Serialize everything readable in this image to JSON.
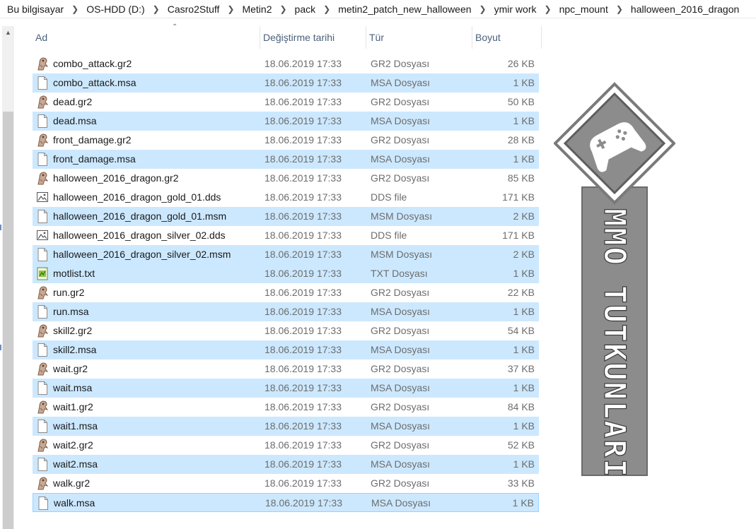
{
  "breadcrumb": [
    "Bu bilgisayar",
    "OS-HDD (D:)",
    "Casro2Stuff",
    "Metin2",
    "pack",
    "metin2_patch_new_halloween",
    "ymir work",
    "npc_mount",
    "halloween_2016_dragon"
  ],
  "columns": {
    "name": "Ad",
    "date": "Değiştirme tarihi",
    "type": "Tür",
    "size": "Boyut"
  },
  "files": [
    {
      "name": "combo_attack.gr2",
      "date": "18.06.2019 17:33",
      "type": "GR2 Dosyası",
      "size": "26 KB",
      "icon": "gr2-icon",
      "selected": false
    },
    {
      "name": "combo_attack.msa",
      "date": "18.06.2019 17:33",
      "type": "MSA Dosyası",
      "size": "1 KB",
      "icon": "file-icon",
      "selected": true
    },
    {
      "name": "dead.gr2",
      "date": "18.06.2019 17:33",
      "type": "GR2 Dosyası",
      "size": "50 KB",
      "icon": "gr2-icon",
      "selected": false
    },
    {
      "name": "dead.msa",
      "date": "18.06.2019 17:33",
      "type": "MSA Dosyası",
      "size": "1 KB",
      "icon": "file-icon",
      "selected": true
    },
    {
      "name": "front_damage.gr2",
      "date": "18.06.2019 17:33",
      "type": "GR2 Dosyası",
      "size": "28 KB",
      "icon": "gr2-icon",
      "selected": false
    },
    {
      "name": "front_damage.msa",
      "date": "18.06.2019 17:33",
      "type": "MSA Dosyası",
      "size": "1 KB",
      "icon": "file-icon",
      "selected": true
    },
    {
      "name": "halloween_2016_dragon.gr2",
      "date": "18.06.2019 17:33",
      "type": "GR2 Dosyası",
      "size": "85 KB",
      "icon": "gr2-icon",
      "selected": false
    },
    {
      "name": "halloween_2016_dragon_gold_01.dds",
      "date": "18.06.2019 17:33",
      "type": "DDS file",
      "size": "171 KB",
      "icon": "image-icon",
      "selected": false
    },
    {
      "name": "halloween_2016_dragon_gold_01.msm",
      "date": "18.06.2019 17:33",
      "type": "MSM Dosyası",
      "size": "2 KB",
      "icon": "file-icon",
      "selected": true
    },
    {
      "name": "halloween_2016_dragon_silver_02.dds",
      "date": "18.06.2019 17:33",
      "type": "DDS file",
      "size": "171 KB",
      "icon": "image-icon",
      "selected": false
    },
    {
      "name": "halloween_2016_dragon_silver_02.msm",
      "date": "18.06.2019 17:33",
      "type": "MSM Dosyası",
      "size": "2 KB",
      "icon": "file-icon",
      "selected": true
    },
    {
      "name": "motlist.txt",
      "date": "18.06.2019 17:33",
      "type": "TXT Dosyası",
      "size": "1 KB",
      "icon": "text-file-icon",
      "selected": true
    },
    {
      "name": "run.gr2",
      "date": "18.06.2019 17:33",
      "type": "GR2 Dosyası",
      "size": "22 KB",
      "icon": "gr2-icon",
      "selected": false
    },
    {
      "name": "run.msa",
      "date": "18.06.2019 17:33",
      "type": "MSA Dosyası",
      "size": "1 KB",
      "icon": "file-icon",
      "selected": true
    },
    {
      "name": "skill2.gr2",
      "date": "18.06.2019 17:33",
      "type": "GR2 Dosyası",
      "size": "54 KB",
      "icon": "gr2-icon",
      "selected": false
    },
    {
      "name": "skill2.msa",
      "date": "18.06.2019 17:33",
      "type": "MSA Dosyası",
      "size": "1 KB",
      "icon": "file-icon",
      "selected": true
    },
    {
      "name": "wait.gr2",
      "date": "18.06.2019 17:33",
      "type": "GR2 Dosyası",
      "size": "37 KB",
      "icon": "gr2-icon",
      "selected": false
    },
    {
      "name": "wait.msa",
      "date": "18.06.2019 17:33",
      "type": "MSA Dosyası",
      "size": "1 KB",
      "icon": "file-icon",
      "selected": true
    },
    {
      "name": "wait1.gr2",
      "date": "18.06.2019 17:33",
      "type": "GR2 Dosyası",
      "size": "84 KB",
      "icon": "gr2-icon",
      "selected": false
    },
    {
      "name": "wait1.msa",
      "date": "18.06.2019 17:33",
      "type": "MSA Dosyası",
      "size": "1 KB",
      "icon": "file-icon",
      "selected": true
    },
    {
      "name": "wait2.gr2",
      "date": "18.06.2019 17:33",
      "type": "GR2 Dosyası",
      "size": "52 KB",
      "icon": "gr2-icon",
      "selected": false
    },
    {
      "name": "wait2.msa",
      "date": "18.06.2019 17:33",
      "type": "MSA Dosyası",
      "size": "1 KB",
      "icon": "file-icon",
      "selected": true
    },
    {
      "name": "walk.gr2",
      "date": "18.06.2019 17:33",
      "type": "GR2 Dosyası",
      "size": "33 KB",
      "icon": "gr2-icon",
      "selected": false
    },
    {
      "name": "walk.msa",
      "date": "18.06.2019 17:33",
      "type": "MSA Dosyası",
      "size": "1 KB",
      "icon": "file-icon",
      "selected": true,
      "focused": true
    }
  ],
  "watermark": {
    "text": "MMO TUTKUNLARI"
  },
  "colors": {
    "selection": "#cce8ff",
    "selection_border": "#99d1ff",
    "header_text": "#4c607a",
    "meta_text": "#6d6d6d"
  }
}
